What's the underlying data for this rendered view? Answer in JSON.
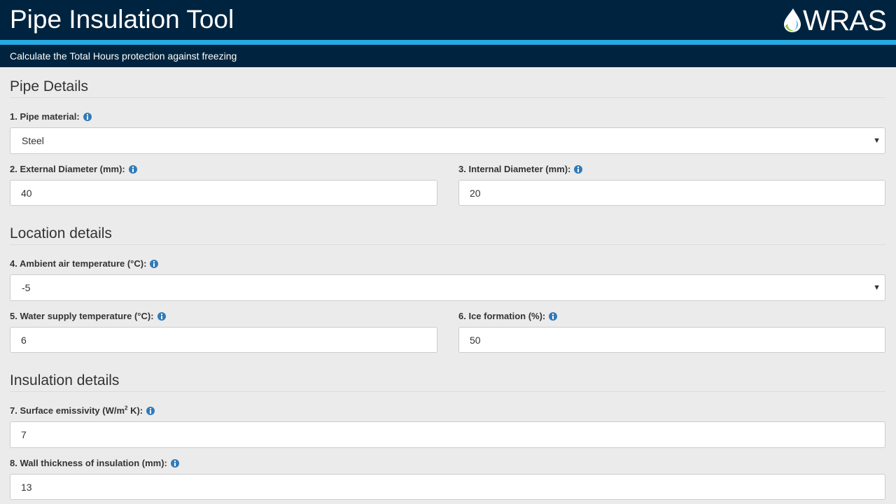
{
  "header": {
    "title": "Pipe Insulation Tool",
    "logo_text": "WRAS",
    "subtitle": "Calculate the Total Hours protection against freezing"
  },
  "sections": {
    "pipe": {
      "title": "Pipe Details"
    },
    "location": {
      "title": "Location details"
    },
    "insulation": {
      "title": "Insulation details"
    }
  },
  "fields": {
    "pipe_material": {
      "label": "1. Pipe material:",
      "value": "Steel"
    },
    "external_diameter": {
      "label": "2. External Diameter (mm):",
      "value": "40"
    },
    "internal_diameter": {
      "label": "3. Internal Diameter (mm):",
      "value": "20"
    },
    "ambient_temp": {
      "label": "4. Ambient air temperature (°C):",
      "value": "-5"
    },
    "water_temp": {
      "label": "5. Water supply temperature (°C):",
      "value": "6"
    },
    "ice_formation": {
      "label": "6. Ice formation (%):",
      "value": "50"
    },
    "surface_emissivity": {
      "label_prefix": "7. Surface emissivity (W/m",
      "label_sup": "2",
      "label_suffix": " K):",
      "value": "7"
    },
    "wall_thickness": {
      "label": "8. Wall thickness of insulation (mm):",
      "value": "13"
    }
  },
  "colors": {
    "header_bg": "#00243f",
    "accent_stripe": "#27a9e1",
    "info_icon": "#337ab7",
    "page_bg": "#ebebeb"
  },
  "icons": [
    "water-drop-logo-icon",
    "info-icon",
    "caret-down-icon"
  ]
}
